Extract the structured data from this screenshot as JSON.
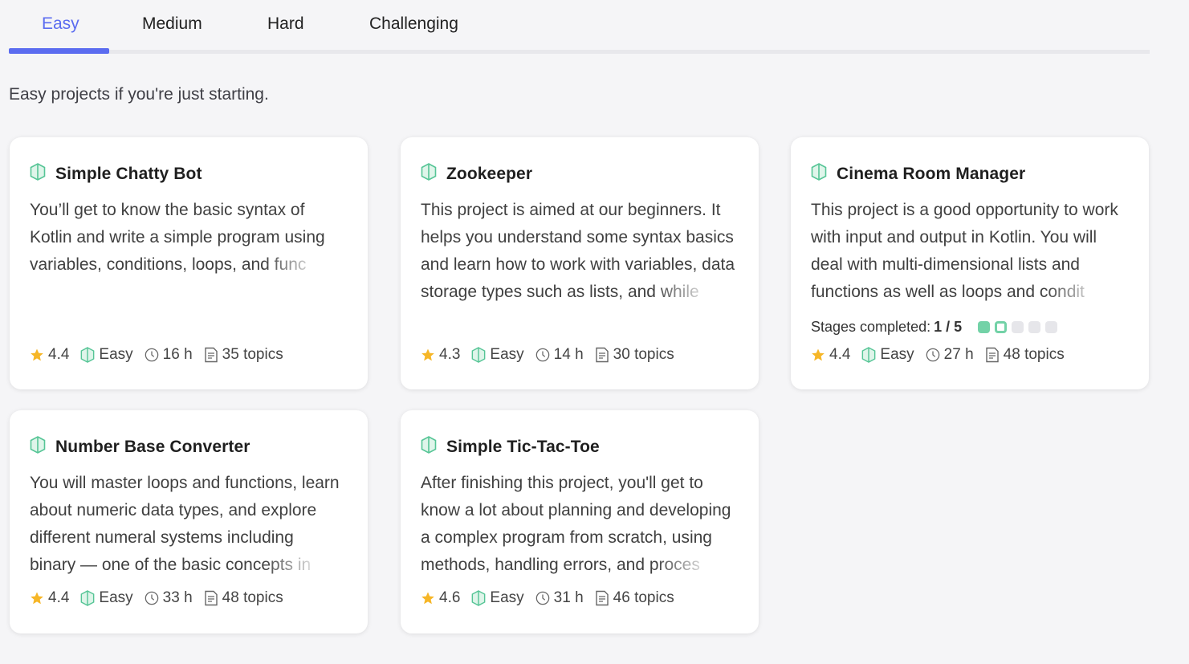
{
  "tabs": [
    {
      "label": "Easy",
      "active": true
    },
    {
      "label": "Medium",
      "active": false
    },
    {
      "label": "Hard",
      "active": false
    },
    {
      "label": "Challenging",
      "active": false
    }
  ],
  "subtitle": "Easy projects if you're just starting.",
  "colors": {
    "accent": "#5b6cf0",
    "gem": "#56c596",
    "star": "#f6b627",
    "progress": "#73d2a7"
  },
  "cards": [
    {
      "title": "Simple Chatty Bot",
      "desc": [
        "You’ll get to know the basic syntax of",
        "Kotlin and write a simple program using",
        "variables, conditions, loops, and func"
      ],
      "rating": "4.4",
      "level": "Easy",
      "hours": "16 h",
      "topics": "35 topics"
    },
    {
      "title": "Zookeeper",
      "desc": [
        "This project is aimed at our beginners. It",
        "helps you understand some syntax basics",
        "and learn how to work with variables, data",
        "storage types such as lists, and while"
      ],
      "rating": "4.3",
      "level": "Easy",
      "hours": "14 h",
      "topics": "30 topics"
    },
    {
      "title": "Cinema Room Manager",
      "desc": [
        "This project is a good opportunity to work",
        "with input and output in Kotlin. You will",
        "deal with multi-dimensional lists and",
        "functions as well as loops and condit"
      ],
      "stages_label": "Stages completed:",
      "stages_value": "1 / 5",
      "stages_completed": 1,
      "stages_total": 5,
      "rating": "4.4",
      "level": "Easy",
      "hours": "27 h",
      "topics": "48 topics"
    },
    {
      "title": "Number Base Converter",
      "desc": [
        "You will master loops and functions, learn",
        "about numeric data types, and explore",
        "different numeral systems including",
        "binary — one of the basic concepts in"
      ],
      "rating": "4.4",
      "level": "Easy",
      "hours": "33 h",
      "topics": "48 topics"
    },
    {
      "title": "Simple Tic-Tac-Toe",
      "desc": [
        "After finishing this project, you'll get to",
        "know a lot about planning and developing",
        "a complex program from scratch, using",
        "methods, handling errors, and proces"
      ],
      "rating": "4.6",
      "level": "Easy",
      "hours": "31 h",
      "topics": "46 topics"
    }
  ]
}
